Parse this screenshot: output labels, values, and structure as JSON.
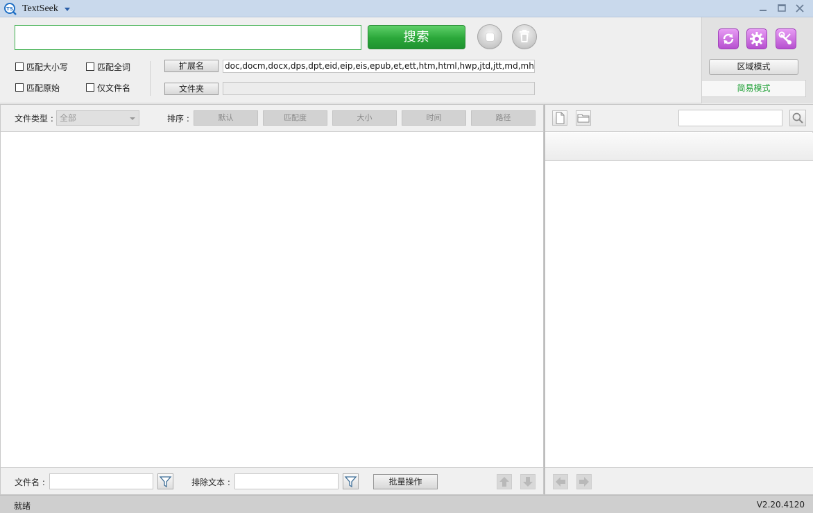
{
  "window": {
    "title": "TextSeek"
  },
  "search": {
    "query": "",
    "button_label": "搜索"
  },
  "options": {
    "match_case": "匹配大小写",
    "match_whole": "匹配全词",
    "match_original": "匹配原始",
    "filename_only": "仅文件名"
  },
  "scope": {
    "extensions_button": "扩展名",
    "extensions_value": "doc,docm,docx,dps,dpt,eid,eip,eis,epub,et,ett,htm,html,hwp,jtd,jtt,md,mht,mhtml,od",
    "folder_button": "文件夹",
    "folder_value": ""
  },
  "modes": {
    "region_mode": "区域模式",
    "simple_mode": "简易模式"
  },
  "filter": {
    "file_type_label": "文件类型 :",
    "file_type_value": "全部",
    "sort_label": "排序 :",
    "sort_options": [
      "默认",
      "匹配度",
      "大小",
      "时间",
      "路径"
    ]
  },
  "bottom": {
    "filename_label": "文件名 :",
    "exclude_label": "排除文本 :",
    "batch_button": "批量操作"
  },
  "status": {
    "text": "就绪",
    "version": "V2.20.4120"
  },
  "colors": {
    "accent_green": "#2aa739",
    "titlebar": "#c9d9ec",
    "purple": "#b64fcf"
  }
}
